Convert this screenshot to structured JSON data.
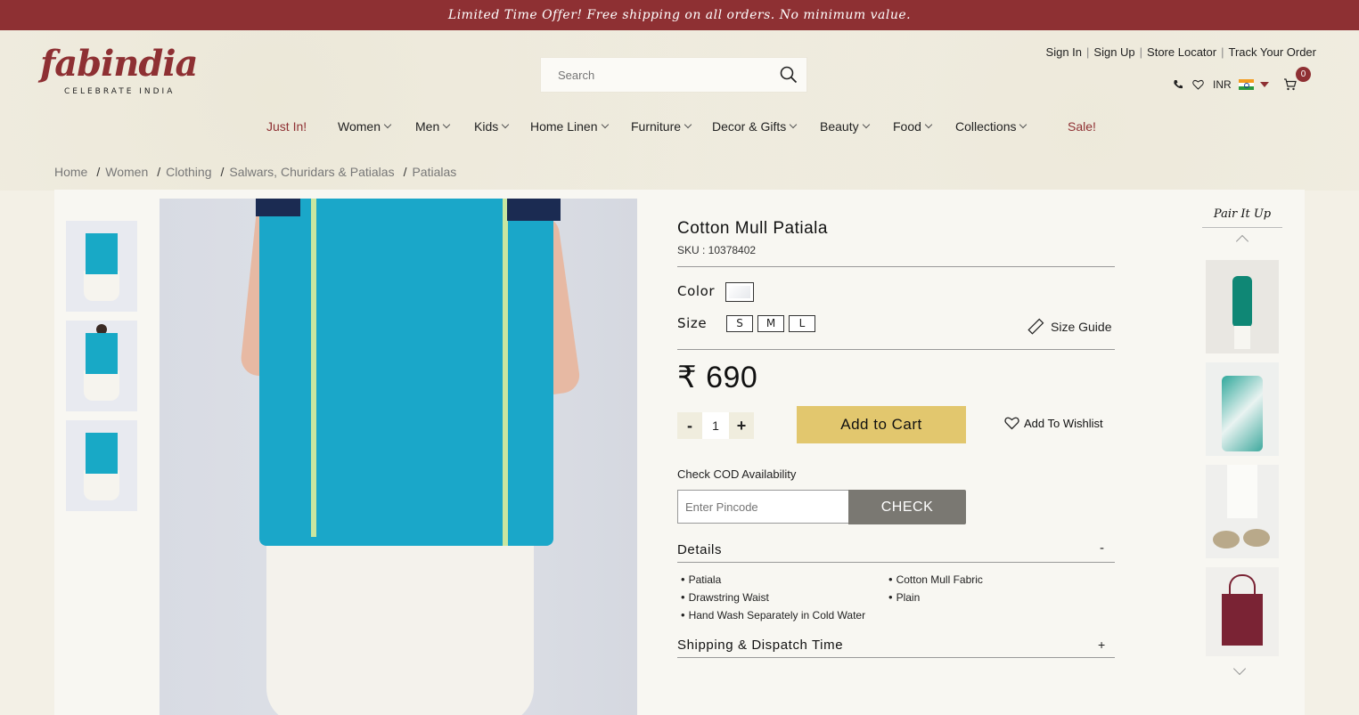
{
  "promo": "Limited Time Offer! Free shipping on all orders. No minimum value.",
  "brand": {
    "name": "fabindia",
    "tagline": "CELEBRATE INDIA",
    "color": "#8e3033"
  },
  "search": {
    "placeholder": "Search"
  },
  "account_links": [
    "Sign In",
    "Sign Up",
    "Store Locator",
    "Track Your Order"
  ],
  "utility": {
    "currency": "INR",
    "cart_count": "0"
  },
  "nav": [
    "Just In!",
    "Women",
    "Men",
    "Kids",
    "Home Linen",
    "Furniture",
    "Decor & Gifts",
    "Beauty",
    "Food",
    "Collections",
    "Sale!"
  ],
  "breadcrumb": [
    "Home",
    "Women",
    "Clothing",
    "Salwars, Churidars & Patialas",
    "Patialas"
  ],
  "product": {
    "title": "Cotton Mull Patiala",
    "sku": "SKU : 10378402",
    "color_label": "Color",
    "size_label": "Size",
    "sizes": [
      "S",
      "M",
      "L"
    ],
    "size_guide": "Size Guide",
    "price": "₹ 690",
    "qty_minus": "-",
    "qty": "1",
    "qty_plus": "+",
    "add_to_cart": "Add to Cart",
    "add_to_wishlist": "Add To Wishlist",
    "cod_label": "Check COD Availability",
    "pincode_placeholder": "Enter Pincode",
    "check": "CHECK",
    "details_title": "Details",
    "details_toggle": "-",
    "details_left": [
      "Patiala",
      "Drawstring Waist",
      "Hand Wash Separately in Cold Water"
    ],
    "details_right": [
      "Cotton Mull Fabric",
      "Plain"
    ],
    "shipping_title": "Shipping & Dispatch Time",
    "shipping_toggle": "+"
  },
  "pair_it_up": {
    "title": "Pair It Up"
  }
}
